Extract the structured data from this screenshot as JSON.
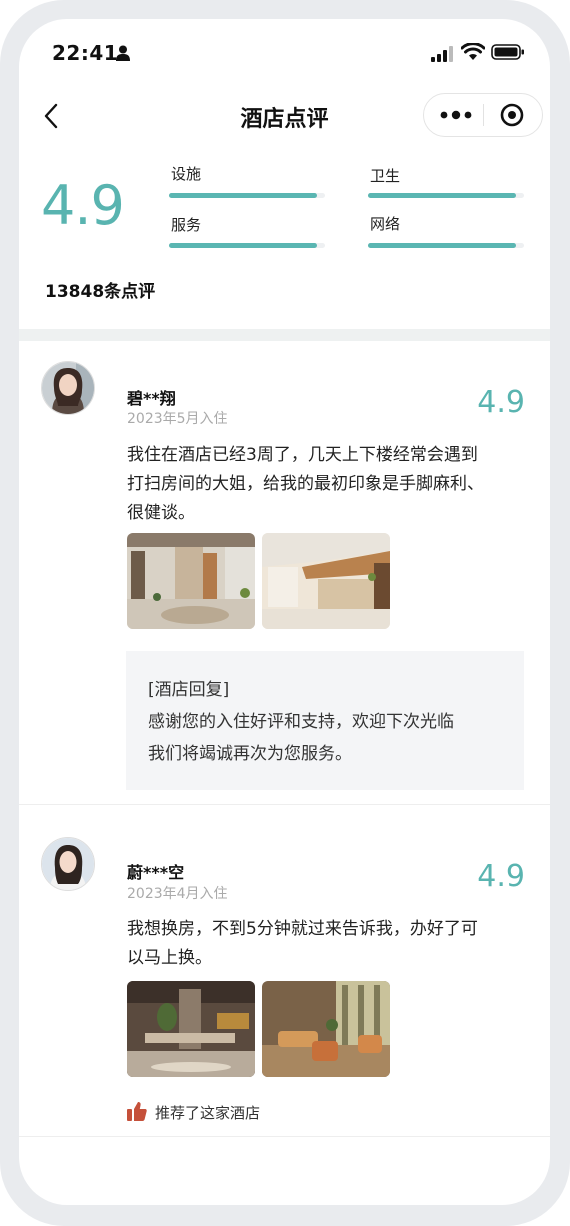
{
  "status_bar": {
    "time": "22:41"
  },
  "nav": {
    "title": "酒店点评"
  },
  "summary": {
    "score": "4.9",
    "count_text": "13848条点评",
    "metrics": [
      {
        "label": "设施",
        "level": 0.95
      },
      {
        "label": "卫生",
        "level": 0.95
      },
      {
        "label": "服务",
        "level": 0.95
      },
      {
        "label": "网络",
        "level": 0.95
      }
    ]
  },
  "reviews": [
    {
      "name": "碧**翔",
      "date": "2023年5月入住",
      "score": "4.9",
      "text_lines": [
        "我住在酒店已经3周了，几天上下楼经常会遇到",
        "打扫房间的大姐，给我的最初印象是手脚麻利、",
        "很健谈。"
      ],
      "reply": {
        "title": "[酒店回复]",
        "lines": [
          "感谢您的入住好评和支持，欢迎下次光临",
          "我们将竭诚再次为您服务。"
        ]
      }
    },
    {
      "name": "蔚***空",
      "date": "2023年4月入住",
      "score": "4.9",
      "text_lines": [
        "我想换房，不到5分钟就过来告诉我，办好了可",
        "以马上换。"
      ],
      "recommend": "推荐了这家酒店"
    }
  ],
  "colors": {
    "accent": "#59b4b0",
    "like": "#c5503a"
  }
}
